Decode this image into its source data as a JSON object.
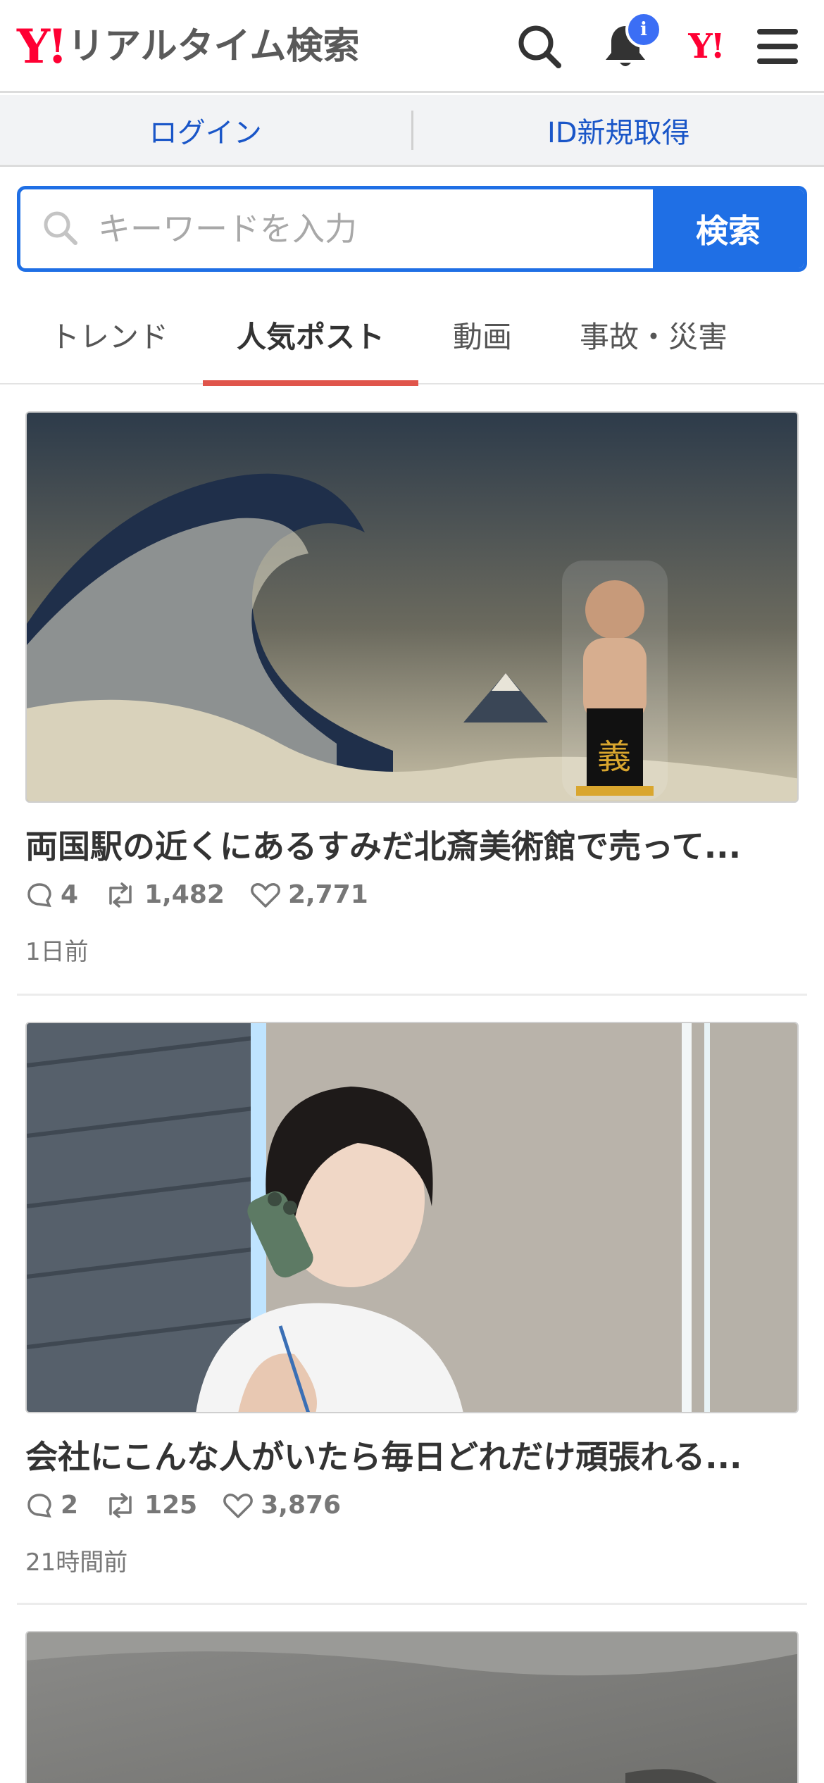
{
  "header": {
    "logo_mark": "Y!",
    "logo_text": "リアルタイム検索",
    "notification_badge": "i",
    "yj_mark": "Y!",
    "icons": [
      "search-icon",
      "bell-icon",
      "yahoo-japan-icon",
      "menu-icon"
    ]
  },
  "auth": {
    "login": "ログイン",
    "register": "ID新規取得"
  },
  "search": {
    "placeholder": "キーワードを入力",
    "button": "検索"
  },
  "tabs": [
    {
      "label": "トレンド",
      "active": false
    },
    {
      "label": "人気ポスト",
      "active": true
    },
    {
      "label": "動画",
      "active": false
    },
    {
      "label": "事故・災害",
      "active": false
    }
  ],
  "posts": [
    {
      "title": "両国駅の近くにあるすみだ北斎美術館で売って...",
      "replies": "4",
      "reposts": "1,482",
      "likes": "2,771",
      "time": "1日前"
    },
    {
      "title": "会社にこんな人がいたら毎日どれだけ頑張れる...",
      "replies": "2",
      "reposts": "125",
      "likes": "3,876",
      "time": "21時間前"
    }
  ],
  "colors": {
    "brand_red": "#ff0033",
    "primary_blue": "#1f6fe5",
    "tab_indicator": "#e0554b",
    "badge_blue": "#3b6ef5"
  }
}
